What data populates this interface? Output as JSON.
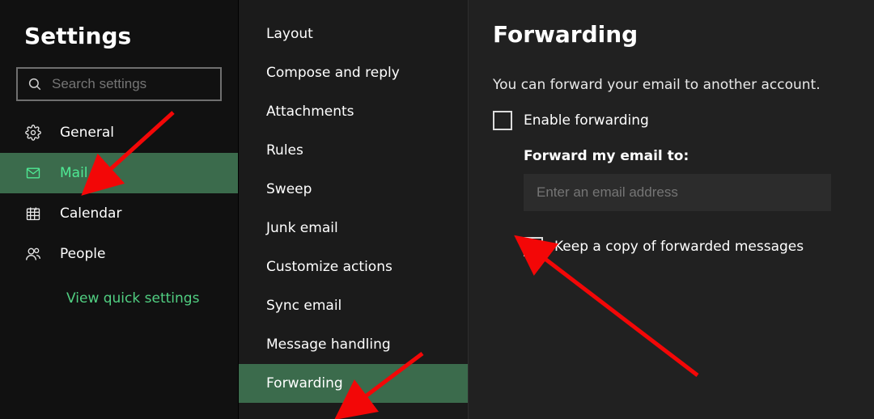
{
  "sidebar": {
    "title": "Settings",
    "search_placeholder": "Search settings",
    "items": [
      {
        "label": "General"
      },
      {
        "label": "Mail"
      },
      {
        "label": "Calendar"
      },
      {
        "label": "People"
      }
    ],
    "quick_link": "View quick settings"
  },
  "sub_panel": {
    "items": [
      {
        "label": "Layout"
      },
      {
        "label": "Compose and reply"
      },
      {
        "label": "Attachments"
      },
      {
        "label": "Rules"
      },
      {
        "label": "Sweep"
      },
      {
        "label": "Junk email"
      },
      {
        "label": "Customize actions"
      },
      {
        "label": "Sync email"
      },
      {
        "label": "Message handling"
      },
      {
        "label": "Forwarding"
      }
    ]
  },
  "main": {
    "title": "Forwarding",
    "description": "You can forward your email to another account.",
    "enable_label": "Enable forwarding",
    "forward_title": "Forward my email to:",
    "email_placeholder": "Enter an email address",
    "keep_copy_label": "Keep a copy of forwarded messages"
  }
}
